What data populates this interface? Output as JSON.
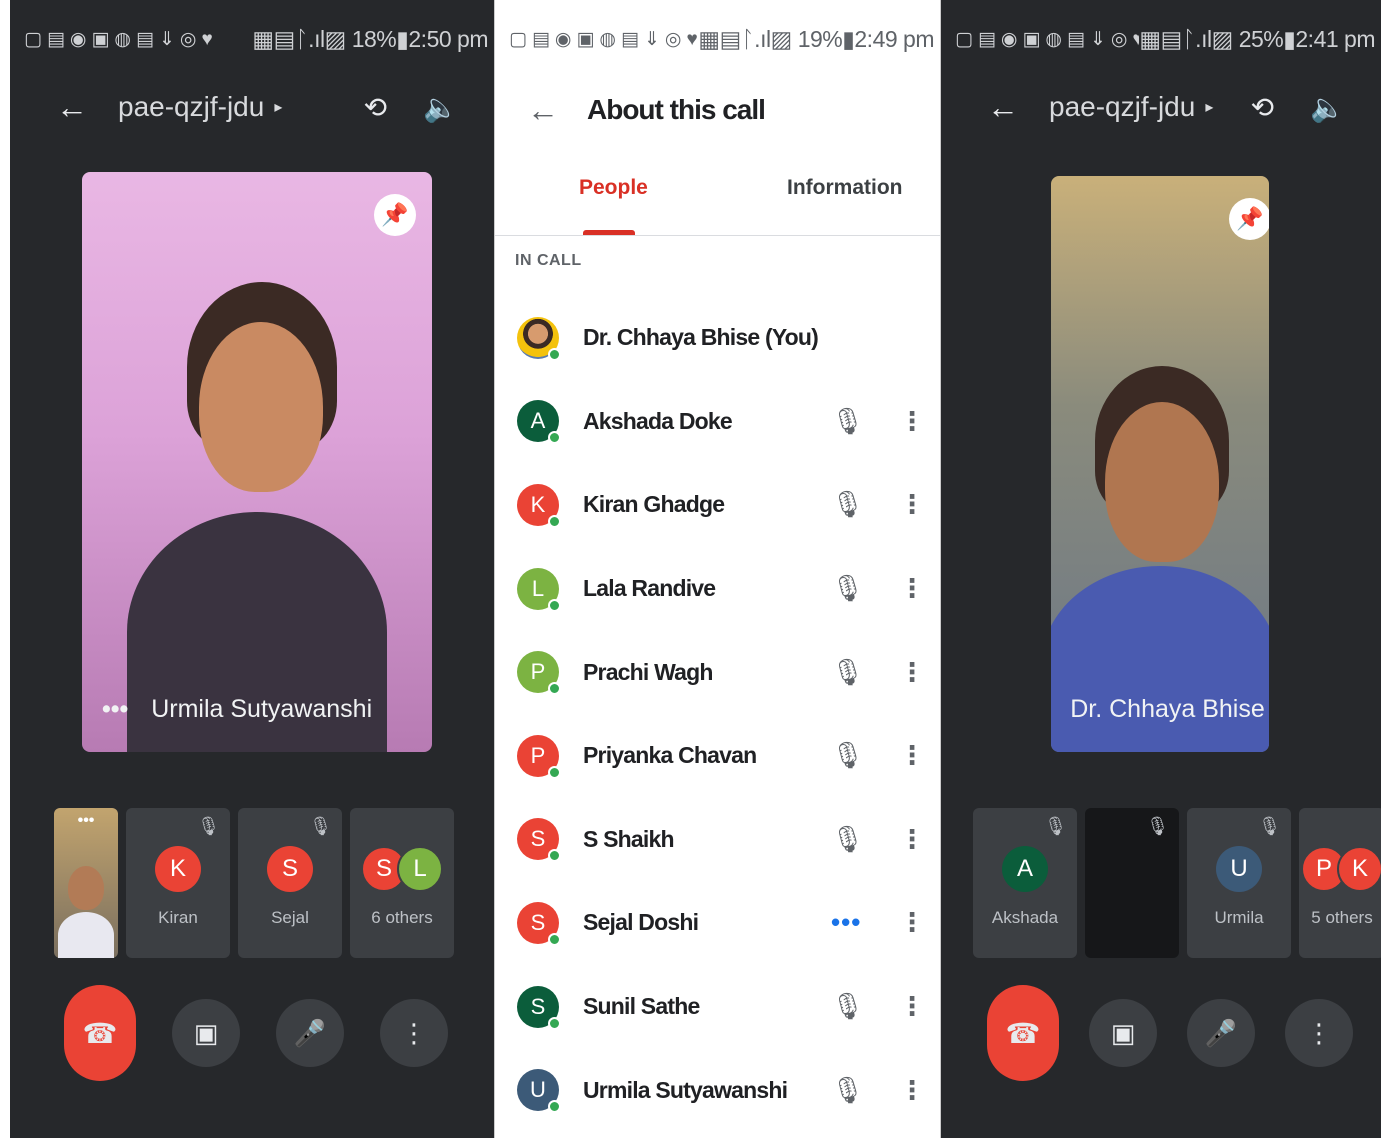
{
  "left_phone": {
    "status": {
      "icons": "▢▤◉▣◍▤⇓◎♥",
      "right": "▦▤ᛚ.ıl▨ 18%▮2:50 pm"
    },
    "header": {
      "meeting_code": "pae-qzjf-jdu",
      "caret": "▸",
      "back_icon": "←",
      "camera_switch_icon": "⟲",
      "speaker_icon": "🔈"
    },
    "main_video": {
      "participant": "Urmila Sutyawanshi",
      "more": "•••",
      "pin_icon": "📌"
    },
    "thumbnails": [
      {
        "type": "self",
        "more": "•••"
      },
      {
        "initial": "K",
        "name": "Kiran",
        "color": "#ea4335",
        "mic": "🎙"
      },
      {
        "initial": "S",
        "name": "Sejal",
        "color": "#ea4335",
        "mic": "🎙"
      },
      {
        "initials": [
          "S",
          "L"
        ],
        "colors": [
          "#ea4335",
          "#7cb342"
        ],
        "name": "6 others"
      }
    ],
    "controls": {
      "end_call": "☎",
      "camera": "▣",
      "mic": "🎤",
      "more": "⋮"
    }
  },
  "middle_phone": {
    "status": {
      "icons": "▢▤◉▣◍▤⇓◎♥",
      "right": "▦▤ᛚ.ıl▨ 19%▮2:49 pm"
    },
    "header": {
      "back_icon": "←",
      "title": "About this call"
    },
    "tabs": {
      "people": "People",
      "information": "Information"
    },
    "section_label": "IN CALL",
    "participants": [
      {
        "name": "Dr. Chhaya Bhise (You)",
        "initial": "",
        "color": "",
        "photo": true,
        "mic": "",
        "more": ""
      },
      {
        "name": "Akshada Doke",
        "initial": "A",
        "color": "#0b5d3b",
        "mic": "🎙",
        "more": "⋮"
      },
      {
        "name": "Kiran Ghadge",
        "initial": "K",
        "color": "#ea4335",
        "mic": "🎙",
        "more": "⋮"
      },
      {
        "name": "Lala Randive",
        "initial": "L",
        "color": "#7cb342",
        "mic": "🎙",
        "more": "⋮"
      },
      {
        "name": "Prachi Wagh",
        "initial": "P",
        "color": "#7cb342",
        "mic": "🎙",
        "more": "⋮"
      },
      {
        "name": "Priyanka Chavan",
        "initial": "P",
        "color": "#ea4335",
        "mic": "🎙",
        "more": "⋮"
      },
      {
        "name": "S Shaikh",
        "initial": "S",
        "color": "#ea4335",
        "mic": "🎙",
        "more": "⋮"
      },
      {
        "name": "Sejal Doshi",
        "initial": "S",
        "color": "#ea4335",
        "mic": "•••",
        "talking": true,
        "more": "⋮"
      },
      {
        "name": "Sunil Sathe",
        "initial": "S",
        "color": "#0b5d3b",
        "mic": "🎙",
        "more": "⋮"
      },
      {
        "name": "Urmila Sutyawanshi",
        "initial": "U",
        "color": "#3c5a78",
        "mic": "🎙",
        "more": "⋮"
      }
    ]
  },
  "right_phone": {
    "status": {
      "icons": "▢▤◉▣◍▤⇓◎♥",
      "right": "▦▤ᛚ.ıl▨ 25%▮2:41 pm"
    },
    "header": {
      "meeting_code": "pae-qzjf-jdu",
      "caret": "▸",
      "back_icon": "←",
      "camera_switch_icon": "⟲",
      "speaker_icon": "🔈"
    },
    "main_video": {
      "participant": "Dr. Chhaya Bhise",
      "more": "•••",
      "pin_icon": "📌"
    },
    "thumbnails": [
      {
        "initial": "A",
        "name": "Akshada",
        "color": "#0b5d3b",
        "mic": "🎙"
      },
      {
        "type": "blank",
        "mic": "🎙"
      },
      {
        "initial": "U",
        "name": "Urmila",
        "color": "#3c5a78",
        "mic": "🎙"
      },
      {
        "initials": [
          "P",
          "K"
        ],
        "colors": [
          "#ea4335",
          "#ea4335"
        ],
        "name": "5 others"
      }
    ],
    "controls": {
      "end_call": "☎",
      "camera": "▣",
      "mic": "🎤",
      "more": "⋮"
    }
  }
}
